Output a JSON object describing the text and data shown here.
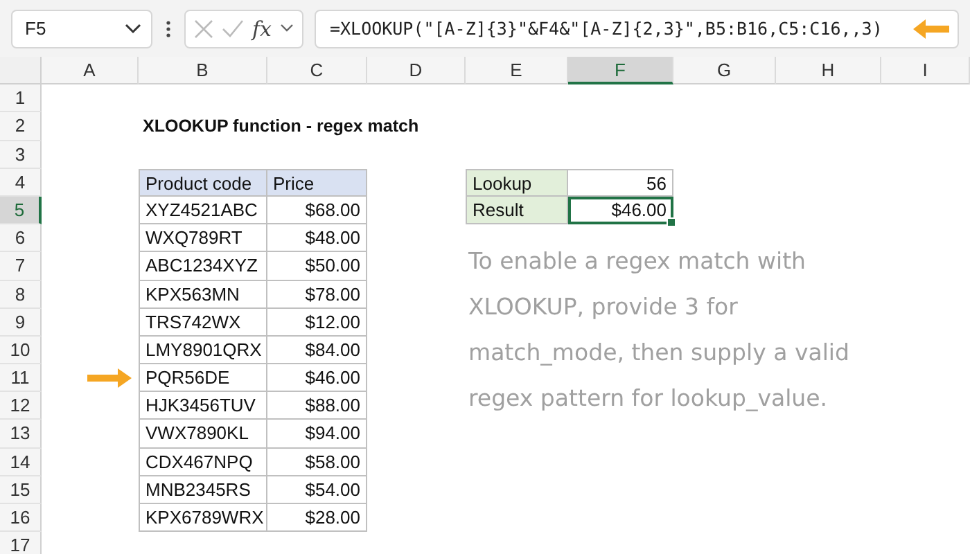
{
  "formula_bar": {
    "name_box": "F5",
    "fx": "fx",
    "formula": "=XLOOKUP(\"[A-Z]{3}\"&F4&\"[A-Z]{2,3}\",B5:B16,C5:C16,,3)",
    "pointer": true
  },
  "columns": [
    {
      "label": "A",
      "selected": false
    },
    {
      "label": "B",
      "selected": false
    },
    {
      "label": "C",
      "selected": false
    },
    {
      "label": "D",
      "selected": false
    },
    {
      "label": "E",
      "selected": false
    },
    {
      "label": "F",
      "selected": true
    },
    {
      "label": "G",
      "selected": false
    },
    {
      "label": "H",
      "selected": false
    },
    {
      "label": "I",
      "selected": false
    }
  ],
  "rows": [
    {
      "label": "1",
      "selected": false
    },
    {
      "label": "2",
      "selected": false
    },
    {
      "label": "3",
      "selected": false
    },
    {
      "label": "4",
      "selected": false
    },
    {
      "label": "5",
      "selected": true
    },
    {
      "label": "6",
      "selected": false
    },
    {
      "label": "7",
      "selected": false
    },
    {
      "label": "8",
      "selected": false
    },
    {
      "label": "9",
      "selected": false
    },
    {
      "label": "10",
      "selected": false
    },
    {
      "label": "11",
      "selected": false
    },
    {
      "label": "12",
      "selected": false
    },
    {
      "label": "13",
      "selected": false
    },
    {
      "label": "14",
      "selected": false
    },
    {
      "label": "15",
      "selected": false
    },
    {
      "label": "16",
      "selected": false
    },
    {
      "label": "17",
      "selected": false
    }
  ],
  "title": "XLOOKUP function - regex match",
  "table": {
    "columns": [
      "Product code",
      "Price"
    ],
    "rows": [
      {
        "code": "XYZ4521ABC",
        "price": "$68.00",
        "pointer": false
      },
      {
        "code": "WXQ789RT",
        "price": "$48.00",
        "pointer": false
      },
      {
        "code": "ABC1234XYZ",
        "price": "$50.00",
        "pointer": false
      },
      {
        "code": "KPX563MN",
        "price": "$78.00",
        "pointer": false
      },
      {
        "code": "TRS742WX",
        "price": "$12.00",
        "pointer": false
      },
      {
        "code": "LMY8901QRX",
        "price": "$84.00",
        "pointer": false
      },
      {
        "code": "PQR56DE",
        "price": "$46.00",
        "pointer": true
      },
      {
        "code": "HJK3456TUV",
        "price": "$88.00",
        "pointer": false
      },
      {
        "code": "VWX7890KL",
        "price": "$94.00",
        "pointer": false
      },
      {
        "code": "CDX467NPQ",
        "price": "$58.00",
        "pointer": false
      },
      {
        "code": "MNB2345RS",
        "price": "$54.00",
        "pointer": false
      },
      {
        "code": "KPX6789WRX",
        "price": "$28.00",
        "pointer": false
      }
    ]
  },
  "lookup": [
    {
      "label": "Lookup",
      "value": "56",
      "selected": false
    },
    {
      "label": "Result",
      "value": "$46.00",
      "selected": true
    }
  ],
  "note": "To enable a regex match with XLOOKUP, provide 3 for match_mode, then supply a valid regex pattern for lookup_value."
}
